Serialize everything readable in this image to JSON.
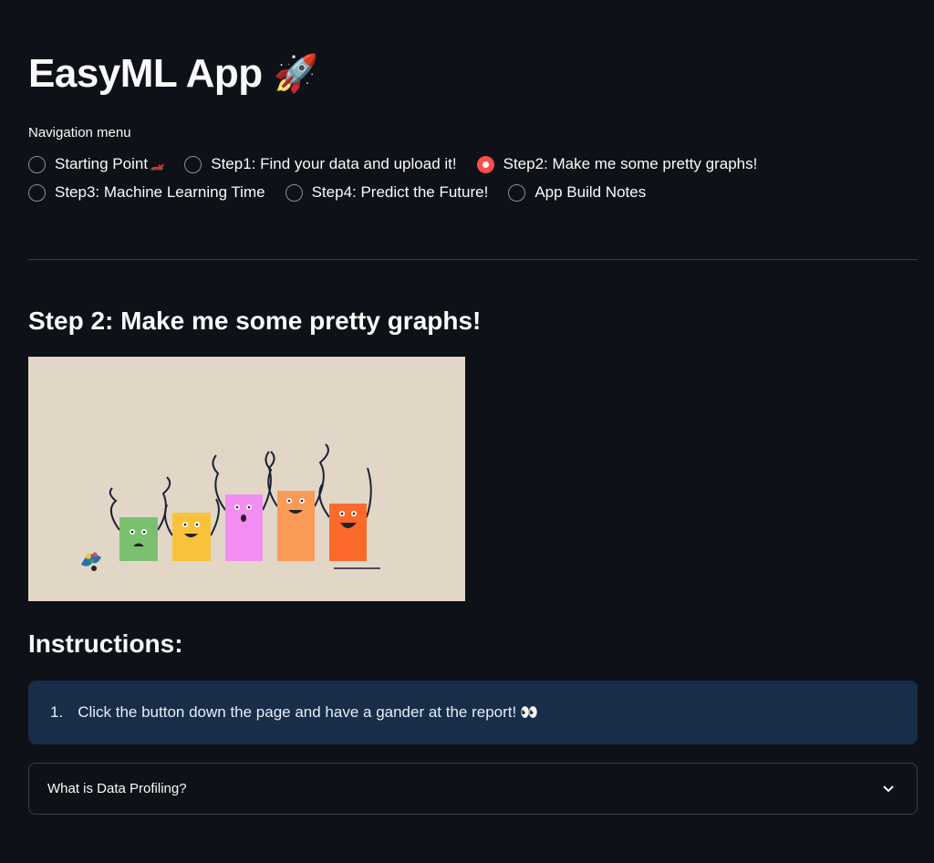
{
  "app": {
    "title": "EasyML App",
    "title_icon": "rocket-icon"
  },
  "navigation": {
    "label": "Navigation menu",
    "options": [
      {
        "label": "Starting Point",
        "selected": false,
        "icon": "race-car-icon"
      },
      {
        "label": "Step1: Find your data and upload it!",
        "selected": false
      },
      {
        "label": "Step2: Make me some pretty graphs!",
        "selected": true
      },
      {
        "label": "Step3: Machine Learning Time",
        "selected": false
      },
      {
        "label": "Step4: Predict the Future!",
        "selected": false
      },
      {
        "label": "App Build Notes",
        "selected": false
      }
    ]
  },
  "main": {
    "section_title": "Step 2: Make me some pretty graphs!",
    "image_icon": "animated-bar-chart-characters",
    "instructions_title": "Instructions:",
    "instructions": [
      {
        "number": "1.",
        "text": "Click the button down the page and have a gander at the report!",
        "icon": "eyes-icon"
      }
    ],
    "expander_label": "What is Data Profiling?"
  },
  "colors": {
    "background": "#0e1117",
    "accent": "#ff4b4b",
    "info_box": "#172d48",
    "image_bg": "#e2d6c7"
  }
}
